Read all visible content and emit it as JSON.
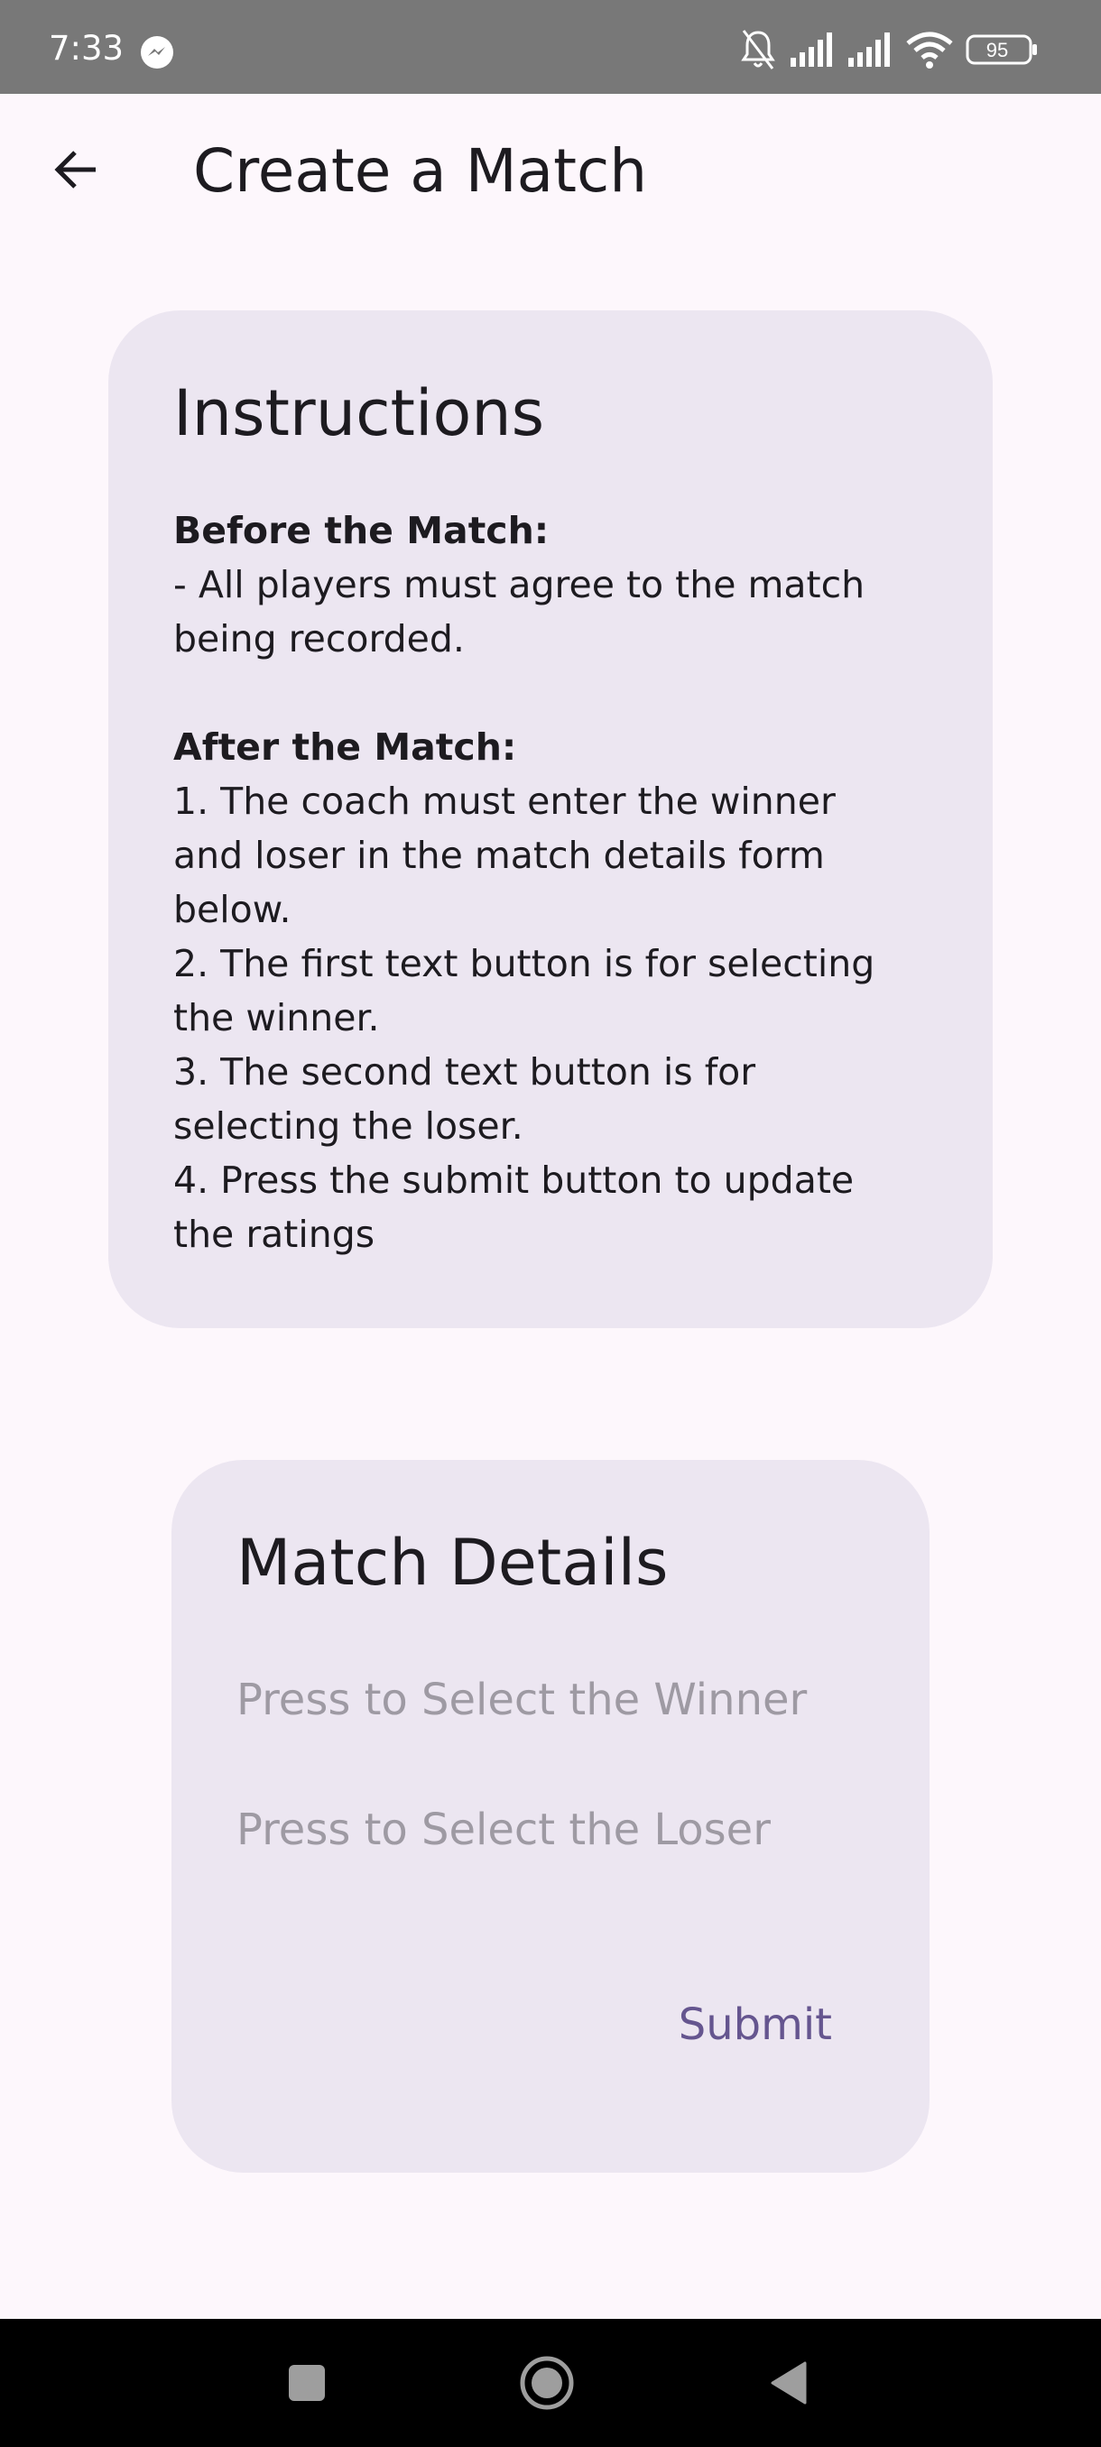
{
  "status_bar": {
    "time": "7:33",
    "battery": "95",
    "icons": [
      "messenger-icon",
      "mute-icon",
      "signal-icon",
      "signal-icon",
      "wifi-icon",
      "battery-icon"
    ]
  },
  "app_bar": {
    "back_icon": "arrow-back-icon",
    "title": "Create a Match"
  },
  "instructions": {
    "title": "Instructions",
    "before_heading": "Before the Match:",
    "before_lines": [
      "- All players must agree to the match",
      "being recorded."
    ],
    "after_heading": "After the Match:",
    "after_lines": [
      "1. The coach must enter the winner",
      "and loser in the match details form",
      "below.",
      "2. The first text button is for selecting",
      "the winner.",
      "3. The second text button is for",
      "selecting the loser.",
      "4. Press the submit button to update",
      "the ratings"
    ]
  },
  "match_details": {
    "title": "Match Details",
    "winner_placeholder": "Press to Select the Winner",
    "loser_placeholder": "Press to Select the Loser",
    "submit_label": "Submit"
  },
  "nav_bar": {
    "icons": [
      "recents-icon",
      "home-icon",
      "back-triangle-icon"
    ]
  },
  "colors": {
    "background": "#fdf7fc",
    "card": "#ece6f1",
    "primary": "#65558f",
    "placeholder": "#9e9aa3",
    "status_bar": "#787878"
  }
}
